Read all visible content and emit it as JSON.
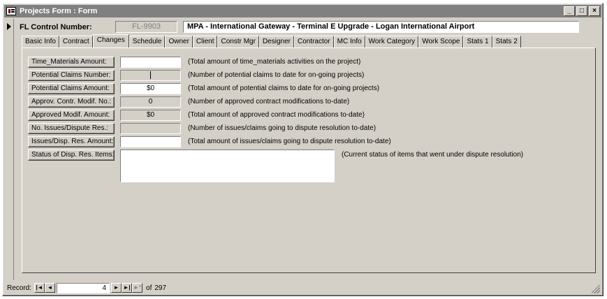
{
  "window": {
    "title": "Projects Form : Form",
    "controls": {
      "minimize": "_",
      "maximize": "□",
      "close": "×"
    }
  },
  "header": {
    "control_label": "FL Control Number:",
    "control_number": "FL-9903",
    "project_name": "MPA - International Gateway - Terminal E Upgrade - Logan International Airport"
  },
  "tabs": [
    {
      "label": "Basic Info",
      "active": false
    },
    {
      "label": "Contract",
      "active": false
    },
    {
      "label": "Changes",
      "active": true
    },
    {
      "label": "Schedule",
      "active": false
    },
    {
      "label": "Owner",
      "active": false
    },
    {
      "label": "Client",
      "active": false
    },
    {
      "label": "Constr Mgr",
      "active": false
    },
    {
      "label": "Designer",
      "active": false
    },
    {
      "label": "Contractor",
      "active": false
    },
    {
      "label": "MC Info",
      "active": false
    },
    {
      "label": "Work Category",
      "active": false
    },
    {
      "label": "Work Scope",
      "active": false
    },
    {
      "label": "Stats 1",
      "active": false
    },
    {
      "label": "Stats 2",
      "active": false
    }
  ],
  "fields": [
    {
      "label": "Time_Materials Amount:",
      "value": "",
      "desc": "(Total amount of time_materials activities on the project)"
    },
    {
      "label": "Potential Claims Number:",
      "value": "",
      "desc": "(Number of potential claims to date for on-going projects)"
    },
    {
      "label": "Potential Claims Amount:",
      "value": "$0",
      "desc": "(Total amount of potential claims to date for on-going projects)"
    },
    {
      "label": "Approv. Contr. Modif. No.:",
      "value": "0",
      "desc": "(Number of approved contract modifications to-date)"
    },
    {
      "label": "Approved Modif. Amount:",
      "value": "$0",
      "desc": "(Total amount of approved contract modifications to-date)"
    },
    {
      "label": "No. Issues/Dispute Res.:",
      "value": "",
      "desc": "(Number of issues/claims going to dispute resolution to-date)"
    },
    {
      "label": "Issues/Disp. Res. Amount:",
      "value": "",
      "desc": "(Total amount of issues/claims going to dispute resolution to-date)"
    }
  ],
  "status_field": {
    "label": "Status of Disp. Res. Items:",
    "value": "",
    "desc": "(Current status of items that went under dispute resolution)"
  },
  "navigation": {
    "record_label": "Record:",
    "first": "|◄",
    "prev": "◄",
    "current": "4",
    "next": "►",
    "last": "►|",
    "new": "►*",
    "of_label": "of",
    "total": "297"
  }
}
